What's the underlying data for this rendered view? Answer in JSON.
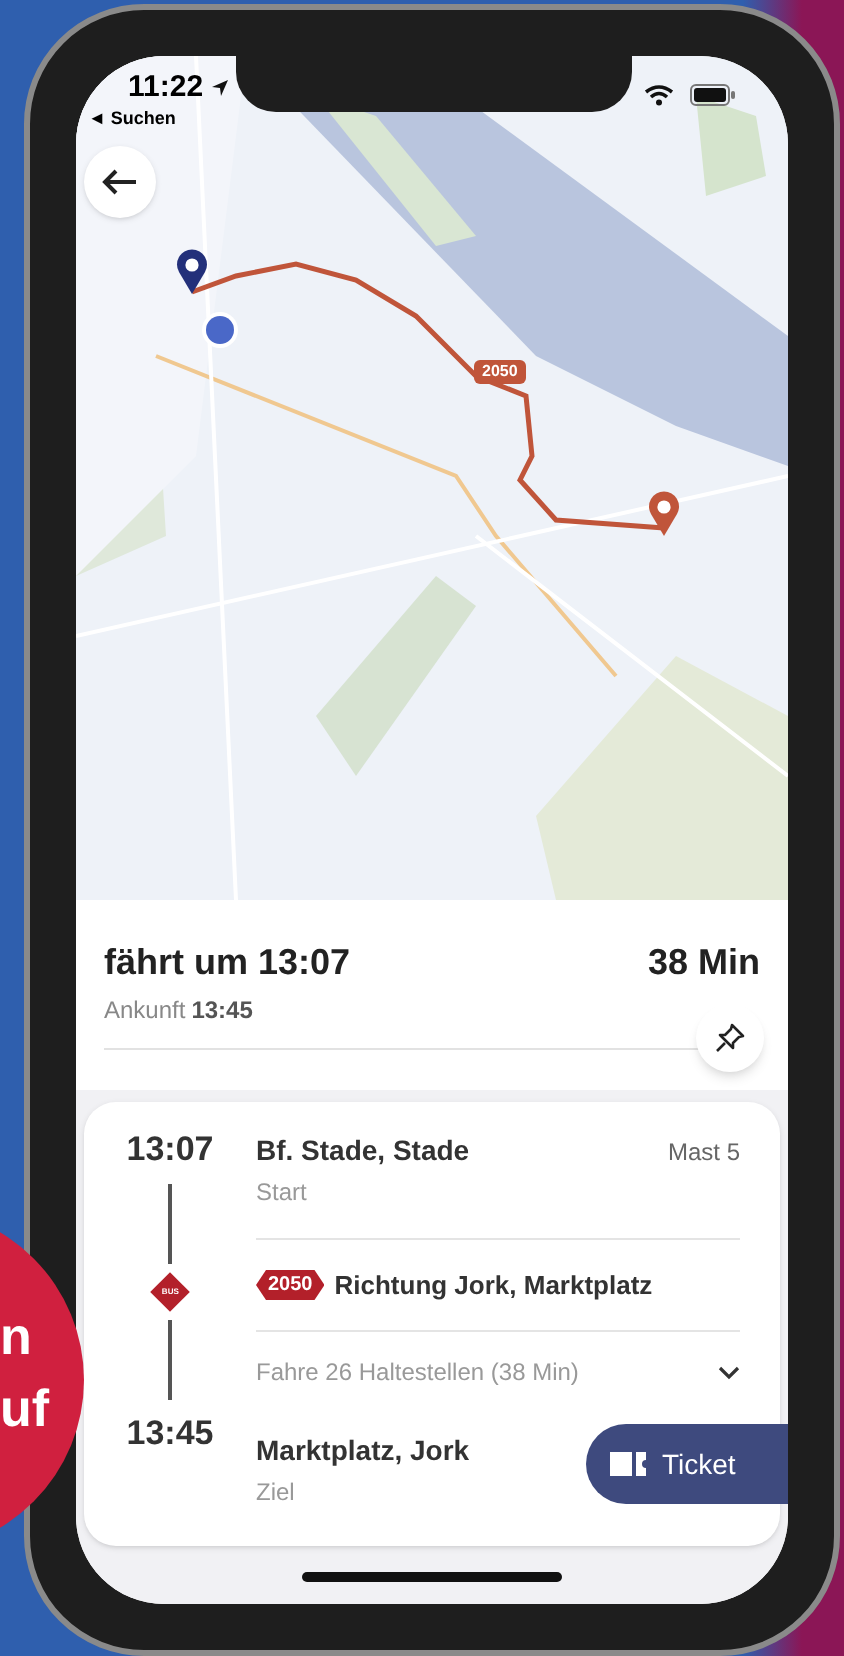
{
  "promo": {
    "lines": [
      "n",
      "uf"
    ]
  },
  "status_bar": {
    "time": "11:22",
    "back_link": "◄ Suchen"
  },
  "map": {
    "kind": "picture",
    "route_label": "2050"
  },
  "summary": {
    "departure": "fährt um 13:07",
    "arrival_label": "Ankunft",
    "arrival_time": "13:45",
    "duration": "38 Min"
  },
  "itinerary": {
    "start": {
      "time": "13:07",
      "stop": "Bf. Stade, Stade",
      "platform": "Mast 5",
      "role": "Start"
    },
    "leg": {
      "mode_label": "BUS",
      "line": "2050",
      "direction": "Richtung Jork, Marktplatz",
      "stops_info": "Fahre 26 Haltestellen (38 Min)",
      "expanded": false
    },
    "end": {
      "time": "13:45",
      "stop": "Marktplatz, Jork",
      "role": "Ziel"
    }
  },
  "ticket_button": {
    "label": "Ticket"
  }
}
